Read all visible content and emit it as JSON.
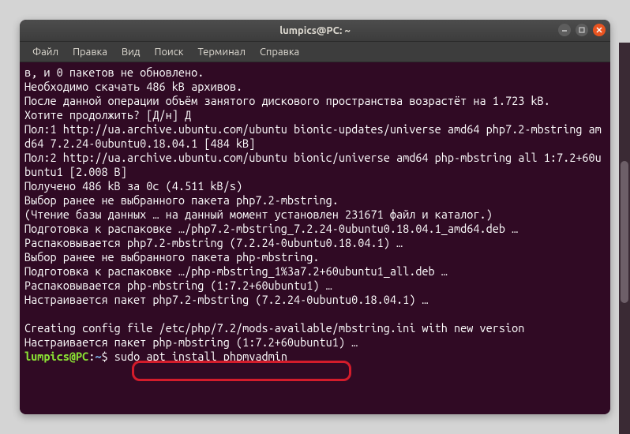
{
  "titlebar": {
    "title": "lumpics@PC: ~"
  },
  "menubar": {
    "items": [
      "Файл",
      "Правка",
      "Вид",
      "Поиск",
      "Терминал",
      "Справка"
    ]
  },
  "terminal": {
    "lines": [
      "в, и 0 пакетов не обновлено.",
      "Необходимо скачать 486 kB архивов.",
      "После данной операции объём занятого дискового пространства возрастёт на 1.723 kB.",
      "Хотите продолжить? [Д/н] Д",
      "Пол:1 http://ua.archive.ubuntu.com/ubuntu bionic-updates/universe amd64 php7.2-mbstring amd64 7.2.24-0ubuntu0.18.04.1 [484 kB]",
      "Пол:2 http://ua.archive.ubuntu.com/ubuntu bionic/universe amd64 php-mbstring all 1:7.2+60ubuntu1 [2.008 B]",
      "Получено 486 kB за 0с (4.511 kB/s)",
      "Выбор ранее не выбранного пакета php7.2-mbstring.",
      "(Чтение базы данных … на данный момент установлен 231671 файл и каталог.)",
      "Подготовка к распаковке …/php7.2-mbstring_7.2.24-0ubuntu0.18.04.1_amd64.deb …",
      "Распаковывается php7.2-mbstring (7.2.24-0ubuntu0.18.04.1) …",
      "Выбор ранее не выбранного пакета php-mbstring.",
      "Подготовка к распаковке …/php-mbstring_1%3a7.2+60ubuntu1_all.deb …",
      "Распаковывается php-mbstring (1:7.2+60ubuntu1) …",
      "Настраивается пакет php7.2-mbstring (7.2.24-0ubuntu0.18.04.1) …",
      "",
      "Creating config file /etc/php/7.2/mods-available/mbstring.ini with new version",
      "Настраивается пакет php-mbstring (1:7.2+60ubuntu1) …"
    ],
    "prompt": {
      "user_host": "lumpics@PC",
      "colon": ":",
      "path": "~",
      "symbol": "$",
      "command": "sudo apt install phpmyadmin"
    }
  }
}
